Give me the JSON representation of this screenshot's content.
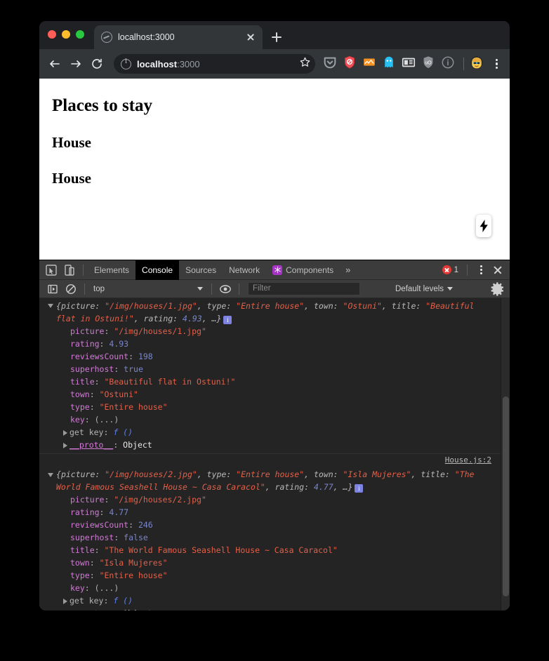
{
  "browser": {
    "tab": {
      "title": "localhost:3000",
      "favicon_icon": "globe-icon",
      "close_icon": "close-icon"
    },
    "new_tab_icon": "plus-icon",
    "nav": {
      "back_icon": "arrow-left-icon",
      "forward_icon": "arrow-right-icon",
      "reload_icon": "reload-icon"
    },
    "omnibox": {
      "site_info_icon": "info-circle-icon",
      "url_host": "localhost",
      "url_port": ":3000",
      "bookmark_icon": "star-icon"
    },
    "extensions": [
      {
        "name": "pocket-icon"
      },
      {
        "name": "shield-blocker-icon"
      },
      {
        "name": "chart-extension-icon"
      },
      {
        "name": "ghostery-icon"
      },
      {
        "name": "reader-card-icon"
      },
      {
        "name": "ublock-origin-icon"
      },
      {
        "name": "info-extension-icon"
      }
    ],
    "profile_icon": "profile-avatar-icon",
    "menu_icon": "kebab-menu-icon"
  },
  "page": {
    "heading": "Places to stay",
    "items": [
      "House",
      "House"
    ],
    "dev_indicator_icon": "lightning-bolt-icon"
  },
  "devtools": {
    "inspect_icon": "inspect-element-icon",
    "device_icon": "device-toolbar-icon",
    "tabs": [
      {
        "label": "Elements",
        "active": false
      },
      {
        "label": "Console",
        "active": true
      },
      {
        "label": "Sources",
        "active": false
      },
      {
        "label": "Network",
        "active": false
      },
      {
        "label": "Components",
        "active": false,
        "icon": "components-icon"
      }
    ],
    "more_tabs_icon": "chevron-double-right-icon",
    "error_count": "1",
    "error_icon": "error-circle-icon",
    "kebab_icon": "kebab-menu-icon",
    "close_icon": "close-icon",
    "filterbar": {
      "sidebar_icon": "console-sidebar-icon",
      "clear_icon": "clear-console-icon",
      "context": "top",
      "eye_icon": "live-expression-icon",
      "filter_placeholder": "Filter",
      "filter_value": "",
      "levels": "Default levels",
      "settings_icon": "gear-icon"
    },
    "console": {
      "entries": [
        {
          "source": "",
          "preview": {
            "open_brace": "{",
            "parts": [
              {
                "key": "picture",
                "value": "\"/img/houses/1.jpg\"",
                "type": "string"
              },
              {
                "key": "type",
                "value": "\"Entire house\"",
                "type": "string"
              },
              {
                "key": "town",
                "value": "\"Ostuni\"",
                "type": "string"
              },
              {
                "key": "title",
                "value": "\"Beautiful flat in Ostuni!\"",
                "type": "string"
              },
              {
                "key": "rating",
                "value": "4.93",
                "type": "number"
              }
            ],
            "ellipsis": ", …}",
            "badge": "i"
          },
          "properties": [
            {
              "key": "picture",
              "value": "\"/img/houses/1.jpg\"",
              "type": "string"
            },
            {
              "key": "rating",
              "value": "4.93",
              "type": "number"
            },
            {
              "key": "reviewsCount",
              "value": "198",
              "type": "number"
            },
            {
              "key": "superhost",
              "value": "true",
              "type": "boolean"
            },
            {
              "key": "title",
              "value": "\"Beautiful flat in Ostuni!\"",
              "type": "string"
            },
            {
              "key": "town",
              "value": "\"Ostuni\"",
              "type": "string"
            },
            {
              "key": "type",
              "value": "\"Entire house\"",
              "type": "string"
            },
            {
              "key": "key",
              "value": "(...)",
              "type": "plain"
            }
          ],
          "getter": {
            "key": "get key",
            "value": "f ()"
          },
          "proto": {
            "key": "__proto__",
            "value": "Object"
          }
        },
        {
          "source": "House.js:2",
          "preview": {
            "open_brace": "{",
            "parts": [
              {
                "key": "picture",
                "value": "\"/img/houses/2.jpg\"",
                "type": "string"
              },
              {
                "key": "type",
                "value": "\"Entire house\"",
                "type": "string"
              },
              {
                "key": "town",
                "value": "\"Isla Mujeres\"",
                "type": "string"
              },
              {
                "key": "title",
                "value": "\"The World Famous Seashell House ~ Casa Caracol\"",
                "type": "string"
              },
              {
                "key": "rating",
                "value": "4.77",
                "type": "number"
              }
            ],
            "ellipsis": ", …}",
            "badge": "i"
          },
          "properties": [
            {
              "key": "picture",
              "value": "\"/img/houses/2.jpg\"",
              "type": "string"
            },
            {
              "key": "rating",
              "value": "4.77",
              "type": "number"
            },
            {
              "key": "reviewsCount",
              "value": "246",
              "type": "number"
            },
            {
              "key": "superhost",
              "value": "false",
              "type": "boolean"
            },
            {
              "key": "title",
              "value": "\"The World Famous Seashell House ~ Casa Caracol\"",
              "type": "string"
            },
            {
              "key": "town",
              "value": "\"Isla Mujeres\"",
              "type": "string"
            },
            {
              "key": "type",
              "value": "\"Entire house\"",
              "type": "string"
            },
            {
              "key": "key",
              "value": "(...)",
              "type": "plain"
            }
          ],
          "getter": {
            "key": "get key",
            "value": "f ()"
          },
          "proto": {
            "key": "__proto__",
            "value": "Object"
          }
        }
      ]
    }
  },
  "colors": {
    "window_chrome": "#202124",
    "tab_active": "#323639",
    "devtools_bg": "#242424",
    "devtools_toolbar": "#3c3c3c",
    "accent_components": "#a435c4",
    "error_red": "#e53935",
    "info_badge": "#7d83e0",
    "string_red": "#e36049",
    "number_blue": "#7986cb",
    "key_magenta": "#d17ad6"
  }
}
